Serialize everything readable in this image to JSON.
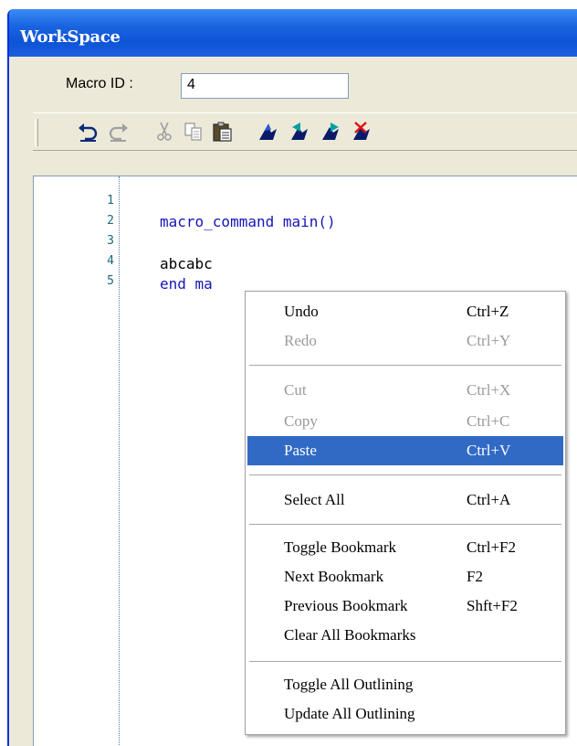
{
  "window": {
    "title": "WorkSpace"
  },
  "macro": {
    "label": "Macro ID :",
    "value": "4"
  },
  "toolbar": {
    "buttons": [
      "undo-icon",
      "redo-icon",
      "cut-icon",
      "copy-icon",
      "paste-icon",
      "toggle-bookmark-icon",
      "next-bookmark-icon",
      "previous-bookmark-icon",
      "clear-bookmarks-icon"
    ]
  },
  "editor": {
    "line_numbers": [
      "1",
      "2",
      "3",
      "4",
      "5"
    ],
    "line2": "macro_command main()",
    "line4": "abcabc",
    "line5": "end ma"
  },
  "context_menu": {
    "undo": {
      "label": "Undo",
      "shortcut": "Ctrl+Z"
    },
    "redo": {
      "label": "Redo",
      "shortcut": "Ctrl+Y"
    },
    "cut": {
      "label": "Cut",
      "shortcut": "Ctrl+X"
    },
    "copy": {
      "label": "Copy",
      "shortcut": "Ctrl+C"
    },
    "paste": {
      "label": "Paste",
      "shortcut": "Ctrl+V"
    },
    "select_all": {
      "label": "Select All",
      "shortcut": "Ctrl+A"
    },
    "toggle_bookmark": {
      "label": "Toggle Bookmark",
      "shortcut": "Ctrl+F2"
    },
    "next_bookmark": {
      "label": "Next Bookmark",
      "shortcut": "F2"
    },
    "previous_bookmark": {
      "label": "Previous Bookmark",
      "shortcut": "Shft+F2"
    },
    "clear_bookmarks": {
      "label": "Clear All Bookmarks"
    },
    "toggle_outlining": {
      "label": "Toggle All Outlining"
    },
    "update_outlining": {
      "label": "Update All Outlining"
    }
  },
  "colors": {
    "highlight": "#316ac5",
    "keyword": "#1515b8",
    "title_bar": "#0e54d6"
  }
}
